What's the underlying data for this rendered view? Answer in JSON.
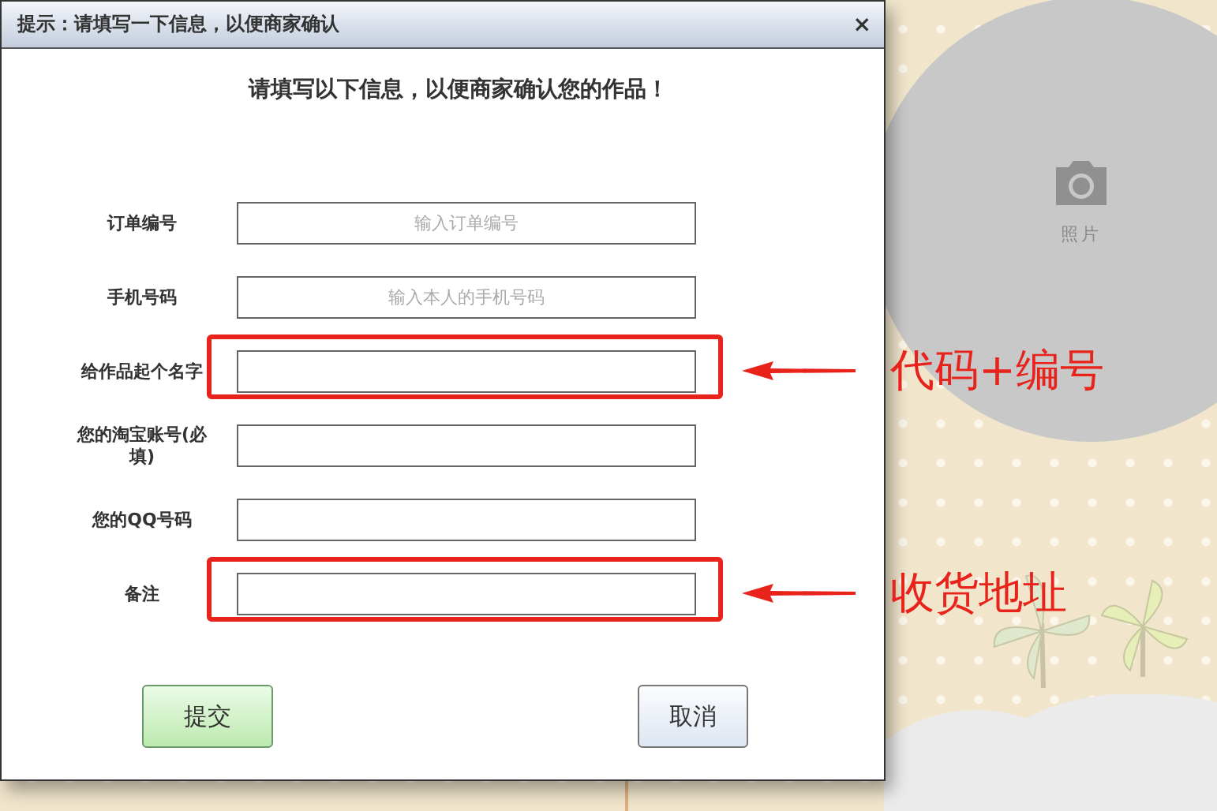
{
  "background": {
    "photo_label": "照片"
  },
  "dialog": {
    "title": "提示：请填写一下信息，以便商家确认",
    "close": "×",
    "heading": "请填写以下信息，以便商家确认您的作品！",
    "fields": [
      {
        "label": "订单编号",
        "placeholder": "输入订单编号"
      },
      {
        "label": "手机号码",
        "placeholder": "输入本人的手机号码"
      },
      {
        "label": "给作品起个名字",
        "annotation": "代码+编号"
      },
      {
        "label": "您的淘宝账号(必填)"
      },
      {
        "label": "您的QQ号码"
      },
      {
        "label": "备注",
        "annotation": "收货地址"
      }
    ],
    "buttons": [
      {
        "label": "提交",
        "kind": "primary"
      },
      {
        "label": "取消",
        "kind": "secondary"
      }
    ]
  }
}
